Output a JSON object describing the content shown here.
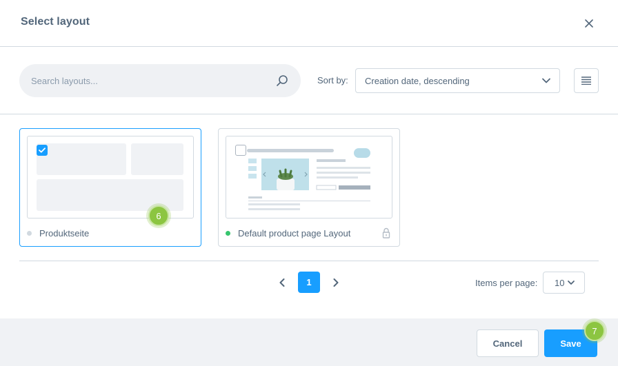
{
  "modal": {
    "title": "Select layout"
  },
  "toolbar": {
    "search_placeholder": "Search layouts...",
    "sort_label": "Sort by:",
    "sort_value": "Creation date, descending"
  },
  "layouts": [
    {
      "name": "Produktseite",
      "selected": true,
      "active": false,
      "locked": false
    },
    {
      "name": "Default product page Layout",
      "selected": false,
      "active": true,
      "locked": true
    }
  ],
  "badges": {
    "card_badge": "6",
    "save_badge": "7"
  },
  "pagination": {
    "current_page": "1",
    "items_per_page_label": "Items per page:",
    "items_per_page_value": "10"
  },
  "footer": {
    "cancel_label": "Cancel",
    "save_label": "Save"
  },
  "colors": {
    "primary": "#189eff",
    "active_dot": "#37c56e",
    "inactive_dot": "#d1d9e0",
    "badge": "#8cc541"
  }
}
